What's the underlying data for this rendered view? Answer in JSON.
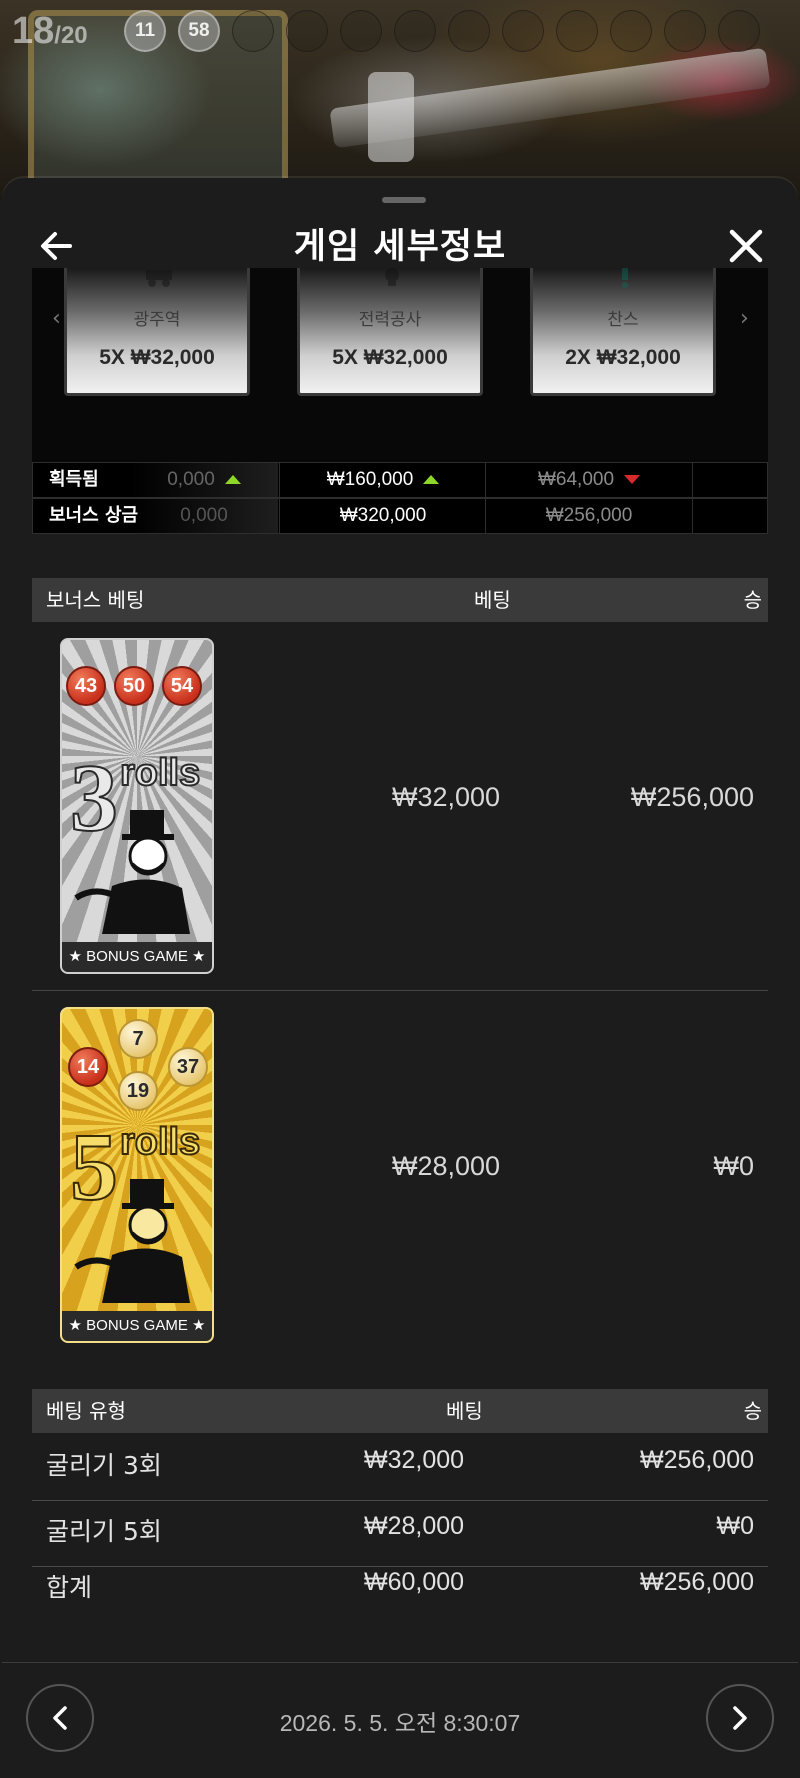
{
  "round": {
    "current": "18",
    "total": "/20"
  },
  "drawn_balls": [
    "11",
    "58"
  ],
  "header": {
    "title": "게임 세부정보",
    "back_icon": "arrow-left-icon",
    "close_icon": "close-icon"
  },
  "multiplier_cards": [
    {
      "name": "광주역",
      "multiplier": "5X ₩32,000"
    },
    {
      "name": "전력공사",
      "multiplier": "5X ₩32,000"
    },
    {
      "name": "찬스",
      "multiplier": "2X ₩32,000"
    }
  ],
  "stats": {
    "won_label": "획득됨",
    "bonus_prize_label": "보너스 상금",
    "won": [
      "0,000",
      "₩160,000",
      "₩64,000"
    ],
    "won_trend": [
      "up",
      "up",
      "down"
    ],
    "bonus_prize": [
      "0,000",
      "₩320,000",
      "₩256,000"
    ]
  },
  "bonus_bets": {
    "headers": {
      "type": "보너스 베팅",
      "bet": "베팅",
      "win": "승"
    },
    "rows": [
      {
        "card_number": "3",
        "card_text": "rolls",
        "card_footer": "★ BONUS GAME ★",
        "balls": [
          "43",
          "50",
          "54"
        ],
        "bet": "₩32,000",
        "win": "₩256,000",
        "style": "silver"
      },
      {
        "card_number": "5",
        "card_text": "rolls",
        "card_footer": "★ BONUS GAME ★",
        "balls": [
          "7",
          "14",
          "37",
          "19"
        ],
        "bet": "₩28,000",
        "win": "₩0",
        "style": "gold"
      }
    ]
  },
  "bet_types": {
    "headers": {
      "type": "베팅 유형",
      "bet": "베팅",
      "win": "승"
    },
    "rows": [
      {
        "type": "굴리기 3회",
        "bet": "₩32,000",
        "win": "₩256,000"
      },
      {
        "type": "굴리기 5회",
        "bet": "₩28,000",
        "win": "₩0"
      }
    ],
    "total": {
      "type": "합계",
      "bet": "₩60,000",
      "win": "₩256,000"
    }
  },
  "footer": {
    "datetime": "2026. 5. 5. 오전 8:30:07",
    "prev_icon": "chevron-left-icon",
    "next_icon": "chevron-right-icon"
  },
  "colors": {
    "up": "#8fd62b",
    "down": "#d72a2a",
    "header_bg": "#3a3a3a"
  }
}
